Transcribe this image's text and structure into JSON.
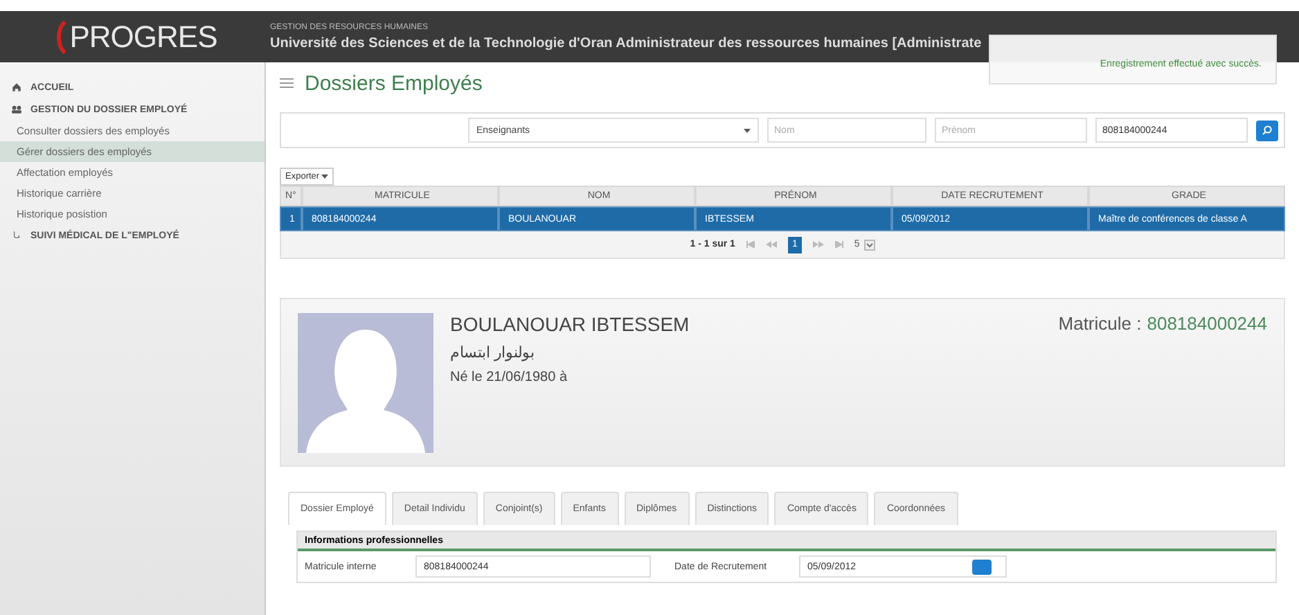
{
  "header": {
    "logo": "PROGRES",
    "subtitle": "GESTION DES RESOURCES HUMAINES",
    "title": "Université des Sciences et de la Technologie d'Oran Administrateur des ressources humaines [Administrate"
  },
  "toast": {
    "message": "Enregistrement effectué avec succès."
  },
  "sidebar": {
    "items": [
      {
        "label": "ACCUEIL",
        "kind": "home"
      },
      {
        "label": "GESTION DU DOSSIER EMPLOYÉ",
        "kind": "group",
        "children": [
          {
            "label": "Consulter dossiers des employés",
            "selected": false
          },
          {
            "label": "Gérer dossiers des employés",
            "selected": true
          },
          {
            "label": "Affectation employés",
            "selected": false
          },
          {
            "label": "Historique carrière",
            "selected": false
          },
          {
            "label": "Historique posistion",
            "selected": false
          }
        ]
      },
      {
        "label": "SUIVI MÉDICAL DE L\"EMPLOYÉ",
        "kind": "medical"
      }
    ]
  },
  "page_title": "Dossiers Employés",
  "filters": {
    "category": "Enseignants",
    "nom_placeholder": "Nom",
    "prenom_placeholder": "Prénom",
    "matricule": "808184000244"
  },
  "export_button": "Exporter",
  "table": {
    "columns": [
      "N°",
      "MATRICULE",
      "NOM",
      "PRÉNOM",
      "DATE RECRUTEMENT",
      "GRADE"
    ],
    "rows": [
      {
        "cells": [
          "1",
          "808184000244",
          "BOULANOUAR",
          "IBTESSEM",
          "05/09/2012",
          "Maître de conférences de classe A"
        ],
        "selected": true
      }
    ]
  },
  "pagination": {
    "summary": "1 - 1 sur 1",
    "pages": [
      {
        "label": "1",
        "selected": true
      }
    ],
    "page_size": "5"
  },
  "profile": {
    "name": "BOULANOUAR IBTESSEM",
    "arabic_name": "بولنوار ابتسام",
    "birth": "Né le 21/06/1980 à",
    "matricule_label": "Matricule :",
    "matricule_value": "808184000244"
  },
  "tabs": [
    {
      "label": "Dossier Employé",
      "selected": true
    },
    {
      "label": "Detail Individu",
      "selected": false
    },
    {
      "label": "Conjoint(s)",
      "selected": false
    },
    {
      "label": "Enfants",
      "selected": false
    },
    {
      "label": "Diplômes",
      "selected": false
    },
    {
      "label": "Distinctions",
      "selected": false
    },
    {
      "label": "Compte d'accès",
      "selected": false
    },
    {
      "label": "Coordonnées",
      "selected": false
    }
  ],
  "section": {
    "title": "Informations professionnelles",
    "fields": [
      {
        "label": "Matricule interne",
        "value": "808184000244",
        "kind": "text"
      },
      {
        "label": "Date de Recrutement",
        "value": "05/09/2012",
        "kind": "date"
      }
    ]
  }
}
